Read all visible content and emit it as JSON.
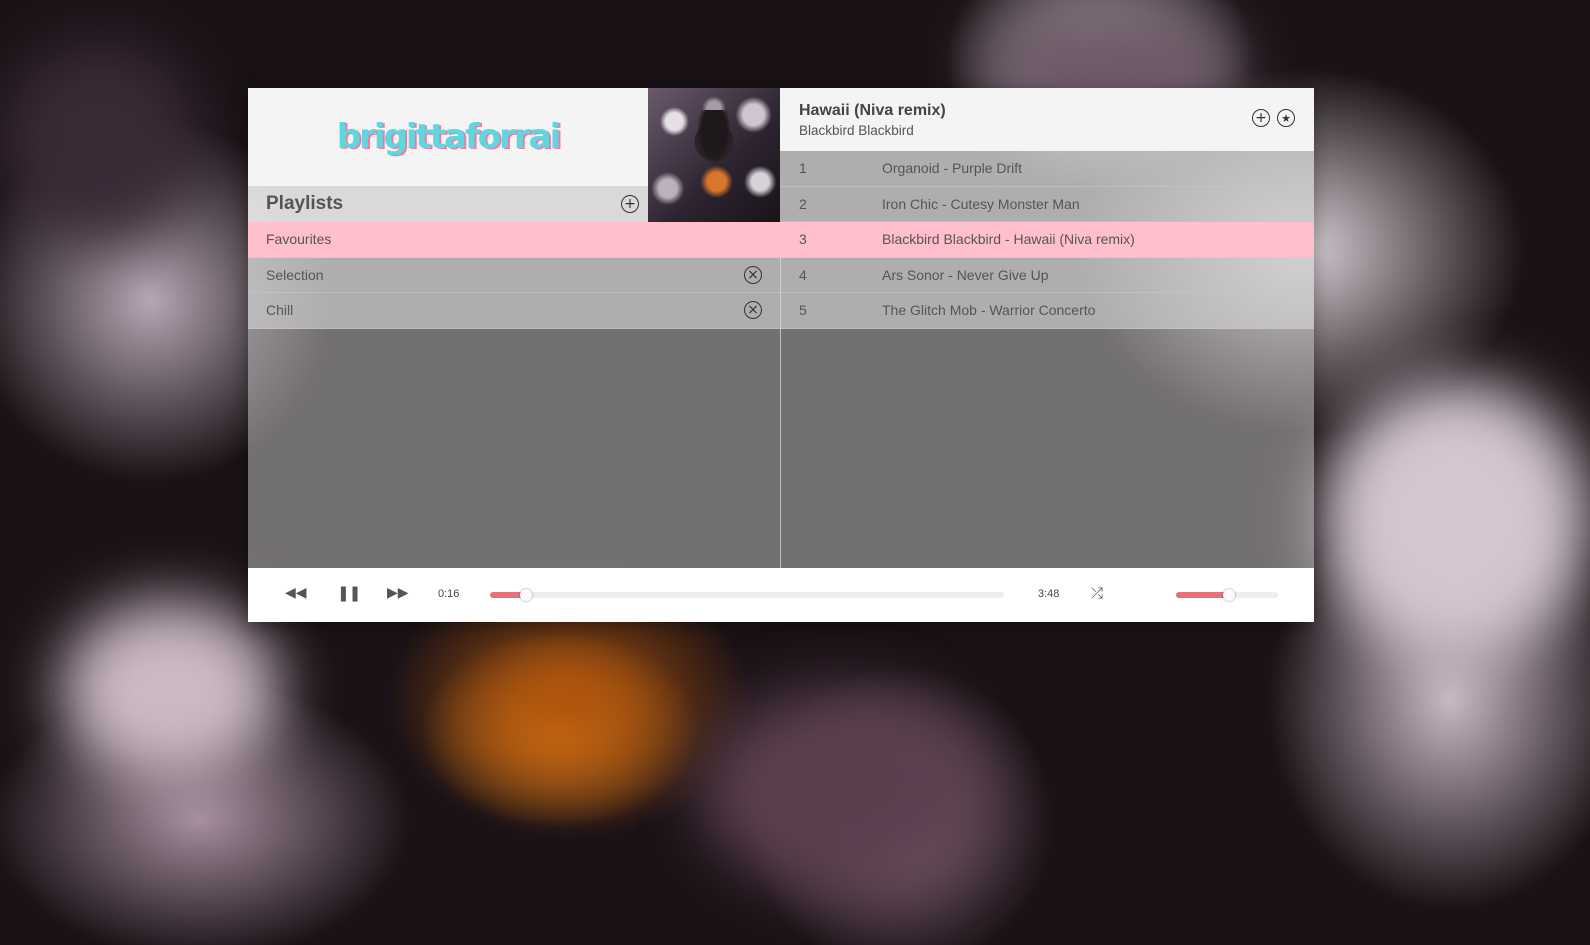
{
  "brand": {
    "logo_text": "brigittaforrai"
  },
  "playlists": {
    "title": "Playlists",
    "add_icon": "plus-circle-icon",
    "items": [
      {
        "label": "Favourites",
        "active": true,
        "removable": false
      },
      {
        "label": "Selection",
        "active": false,
        "removable": true
      },
      {
        "label": "Chill",
        "active": false,
        "removable": true
      }
    ]
  },
  "now_playing": {
    "title": "Hawaii (Niva remix)",
    "artist": "Blackbird Blackbird",
    "add_icon": "plus-circle-icon",
    "favourite_icon": "star-circle-icon"
  },
  "tracks": [
    {
      "num": "1",
      "name": "Organoid - Purple Drift",
      "active": false
    },
    {
      "num": "2",
      "name": "Iron Chic - Cutesy Monster Man",
      "active": false
    },
    {
      "num": "3",
      "name": "Blackbird Blackbird - Hawaii (Niva remix)",
      "active": true
    },
    {
      "num": "4",
      "name": "Ars Sonor - Never Give Up",
      "active": false
    },
    {
      "num": "5",
      "name": "The Glitch Mob - Warrior Concerto",
      "active": false
    }
  ],
  "controls": {
    "current_time": "0:16",
    "total_time": "3:48",
    "progress": 0.07,
    "volume": 0.52,
    "prev_icon": "rewind-icon",
    "pause_icon": "pause-icon",
    "next_icon": "fast-forward-icon",
    "shuffle_icon": "shuffle-icon"
  },
  "colors": {
    "accent": "#e8707a",
    "active_row": "#ffc0cb",
    "logo_primary": "#5fd7de",
    "logo_shadow": "#f07aa6"
  }
}
